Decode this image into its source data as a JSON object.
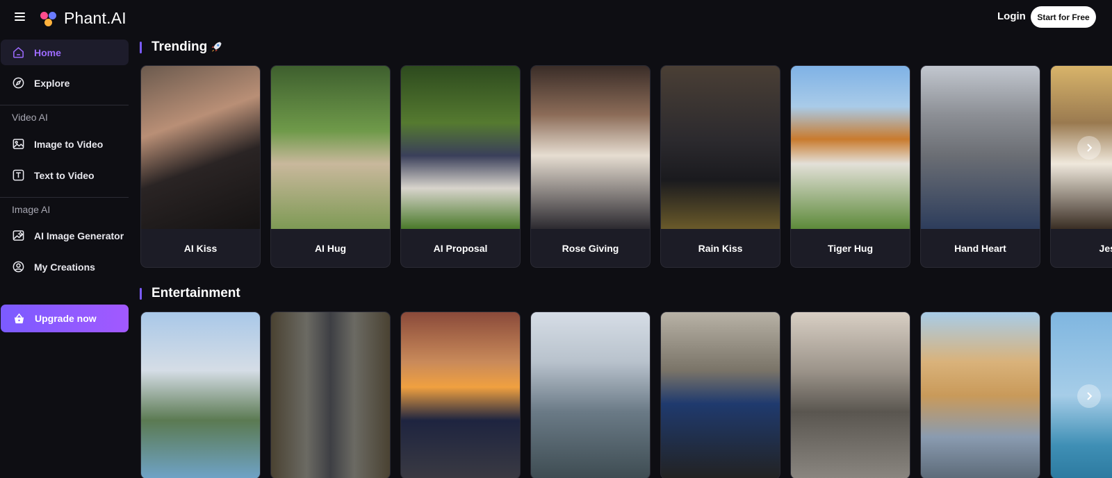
{
  "app": {
    "name": "Phant.AI"
  },
  "header": {
    "login_label": "Login",
    "start_label": "Start for Free"
  },
  "sidebar": {
    "home": "Home",
    "explore": "Explore",
    "video_section": "Video AI",
    "image_to_video": "Image to Video",
    "text_to_video": "Text to Video",
    "image_section": "Image AI",
    "ai_image_generator": "AI Image Generator",
    "my_creations": "My Creations",
    "upgrade": "Upgrade now"
  },
  "trending": {
    "title": "Trending",
    "cards": [
      "AI Kiss",
      "AI Hug",
      "AI Proposal",
      "Rose Giving",
      "Rain Kiss",
      "Tiger Hug",
      "Hand Heart",
      "Jesu"
    ]
  },
  "entertainment": {
    "title": "Entertainment"
  },
  "colors": {
    "accent": "#7b5bff",
    "active_text": "#9d6bff",
    "background": "#0e0e13"
  }
}
